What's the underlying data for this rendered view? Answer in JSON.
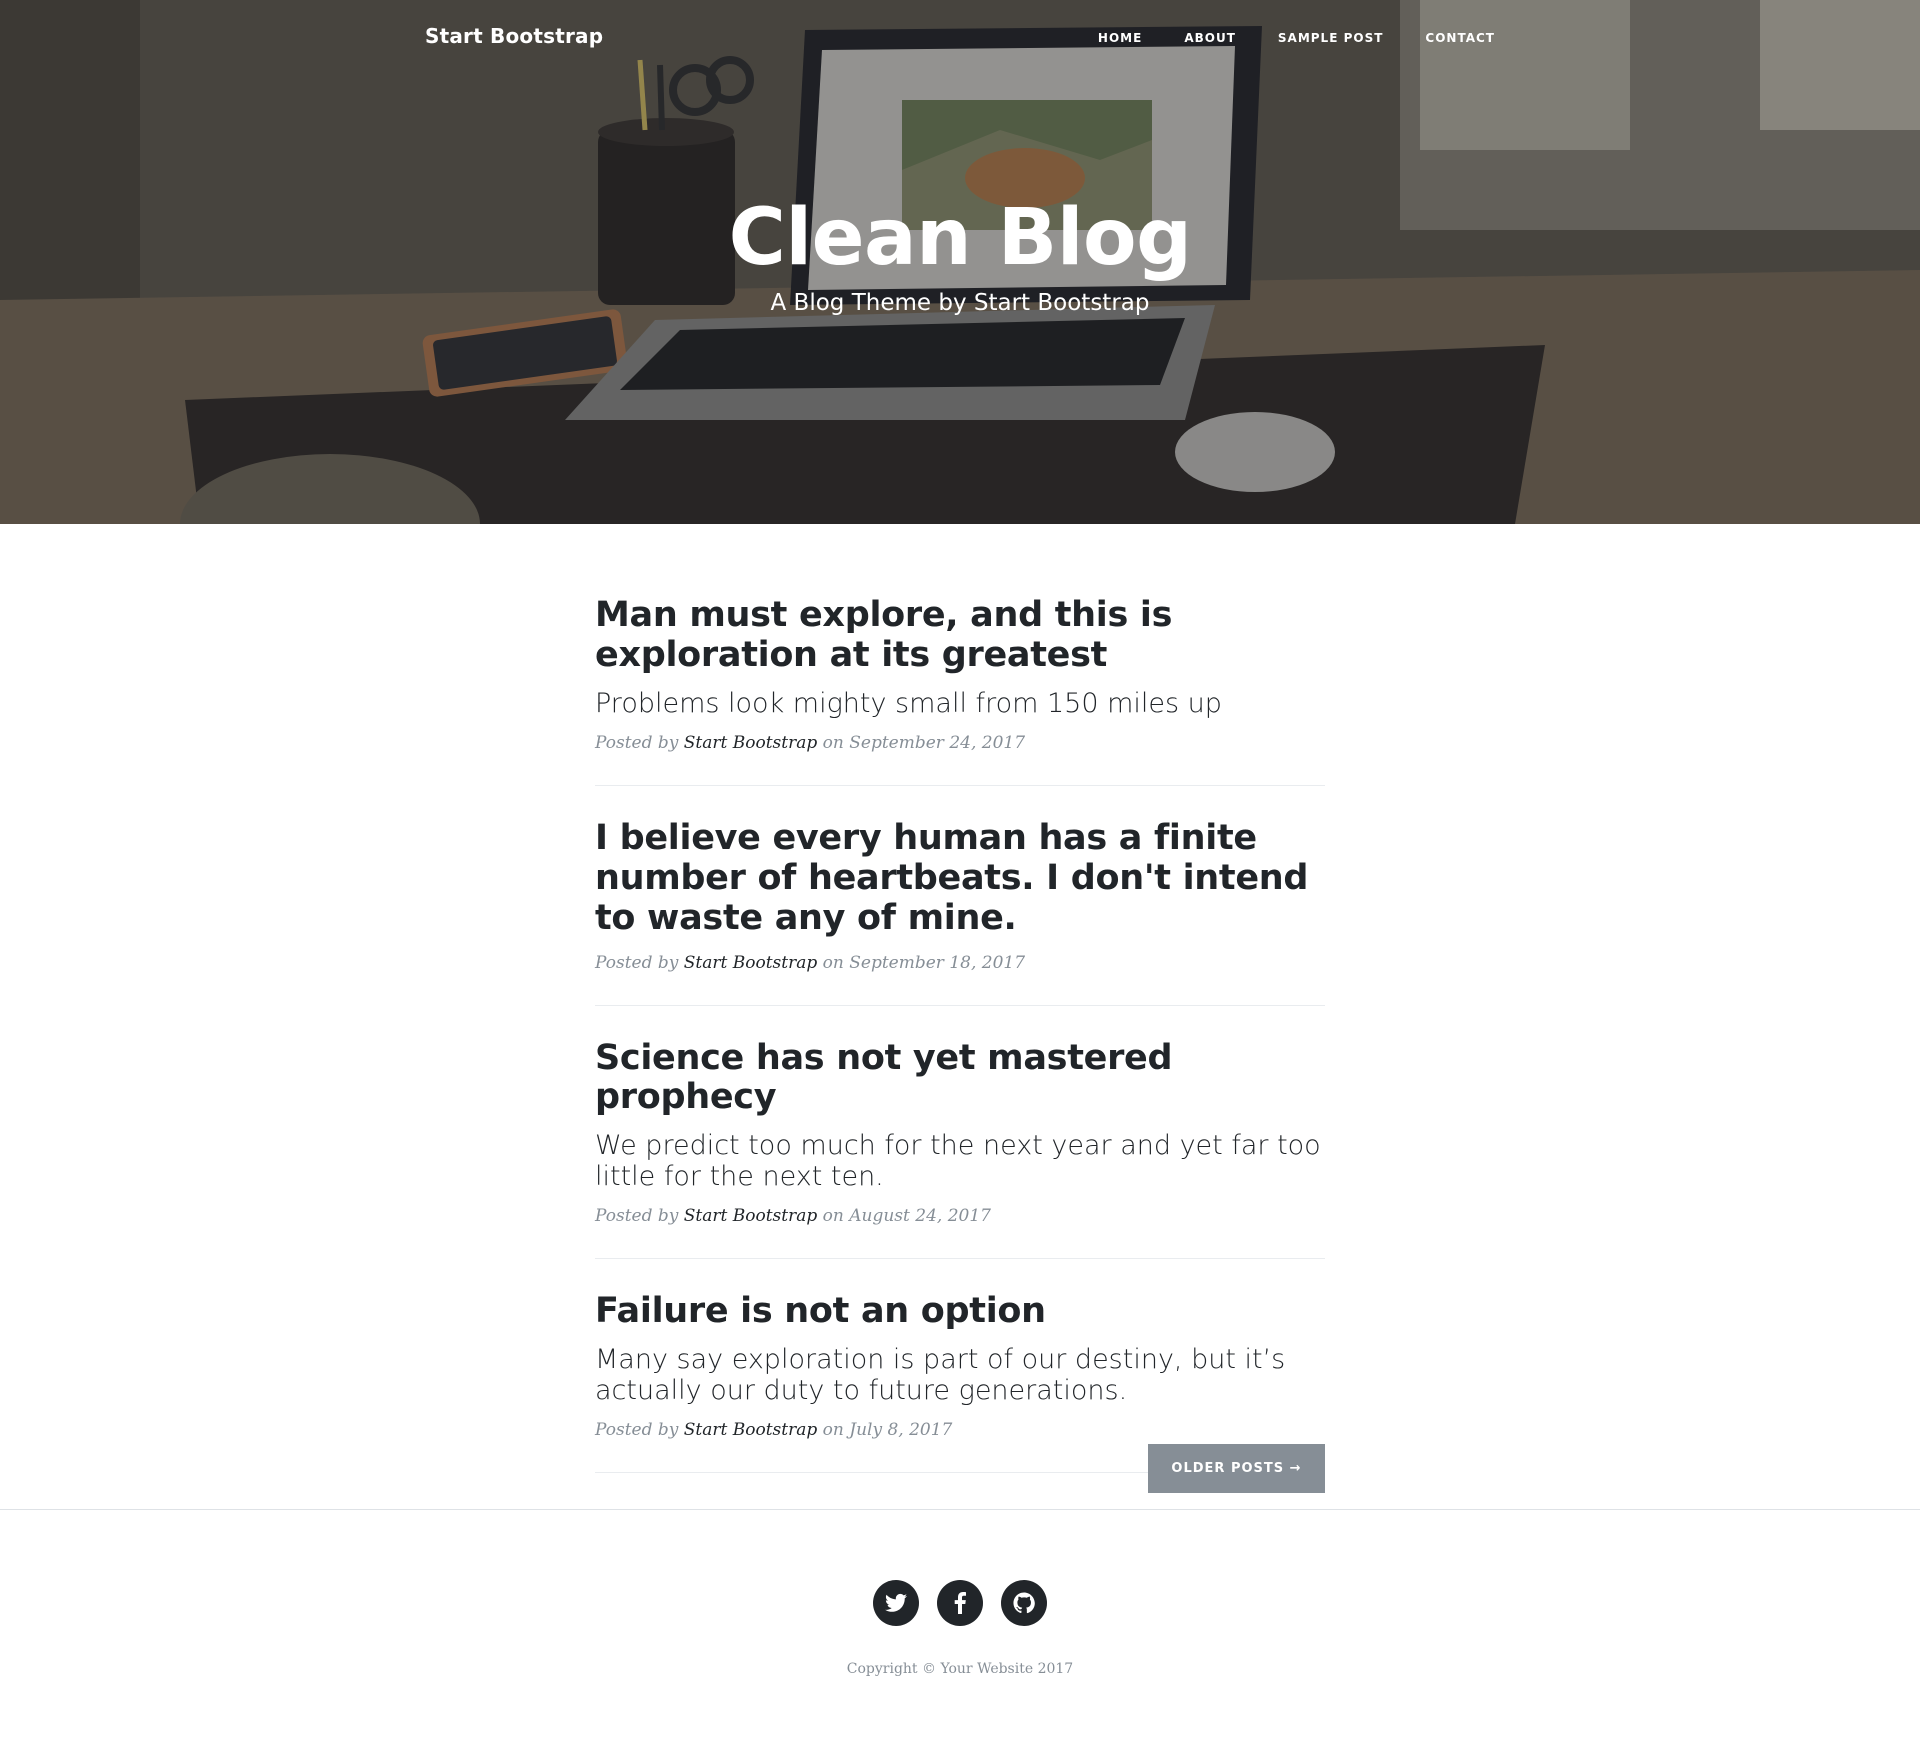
{
  "navbar": {
    "brand": "Start Bootstrap",
    "links": [
      "HOME",
      "ABOUT",
      "SAMPLE POST",
      "CONTACT"
    ]
  },
  "hero": {
    "title": "Clean Blog",
    "subtitle": "A Blog Theme by Start Bootstrap"
  },
  "posts": [
    {
      "title": "Man must explore, and this is exploration at its greatest",
      "subtitle": "Problems look mighty small from 150 miles up",
      "posted_by": "Posted by",
      "author": "Start Bootstrap",
      "on": "on",
      "date": "September 24, 2017"
    },
    {
      "title": "I believe every human has a finite number of heartbeats. I don't intend to waste any of mine.",
      "subtitle": "",
      "posted_by": "Posted by",
      "author": "Start Bootstrap",
      "on": "on",
      "date": "September 18, 2017"
    },
    {
      "title": "Science has not yet mastered prophecy",
      "subtitle": "We predict too much for the next year and yet far too little for the next ten.",
      "posted_by": "Posted by",
      "author": "Start Bootstrap",
      "on": "on",
      "date": "August 24, 2017"
    },
    {
      "title": "Failure is not an option",
      "subtitle": "Many say exploration is part of our destiny, but it’s actually our duty to future generations.",
      "posted_by": "Posted by",
      "author": "Start Bootstrap",
      "on": "on",
      "date": "July 8, 2017"
    }
  ],
  "pager": {
    "older_label": "OLDER POSTS →"
  },
  "footer": {
    "socials": [
      "twitter-icon",
      "facebook-icon",
      "github-icon"
    ],
    "copyright": "Copyright © Your Website 2017"
  },
  "colors": {
    "text": "#212529",
    "muted": "#868e96",
    "button": "#868e96",
    "divider": "#e9ecef"
  }
}
